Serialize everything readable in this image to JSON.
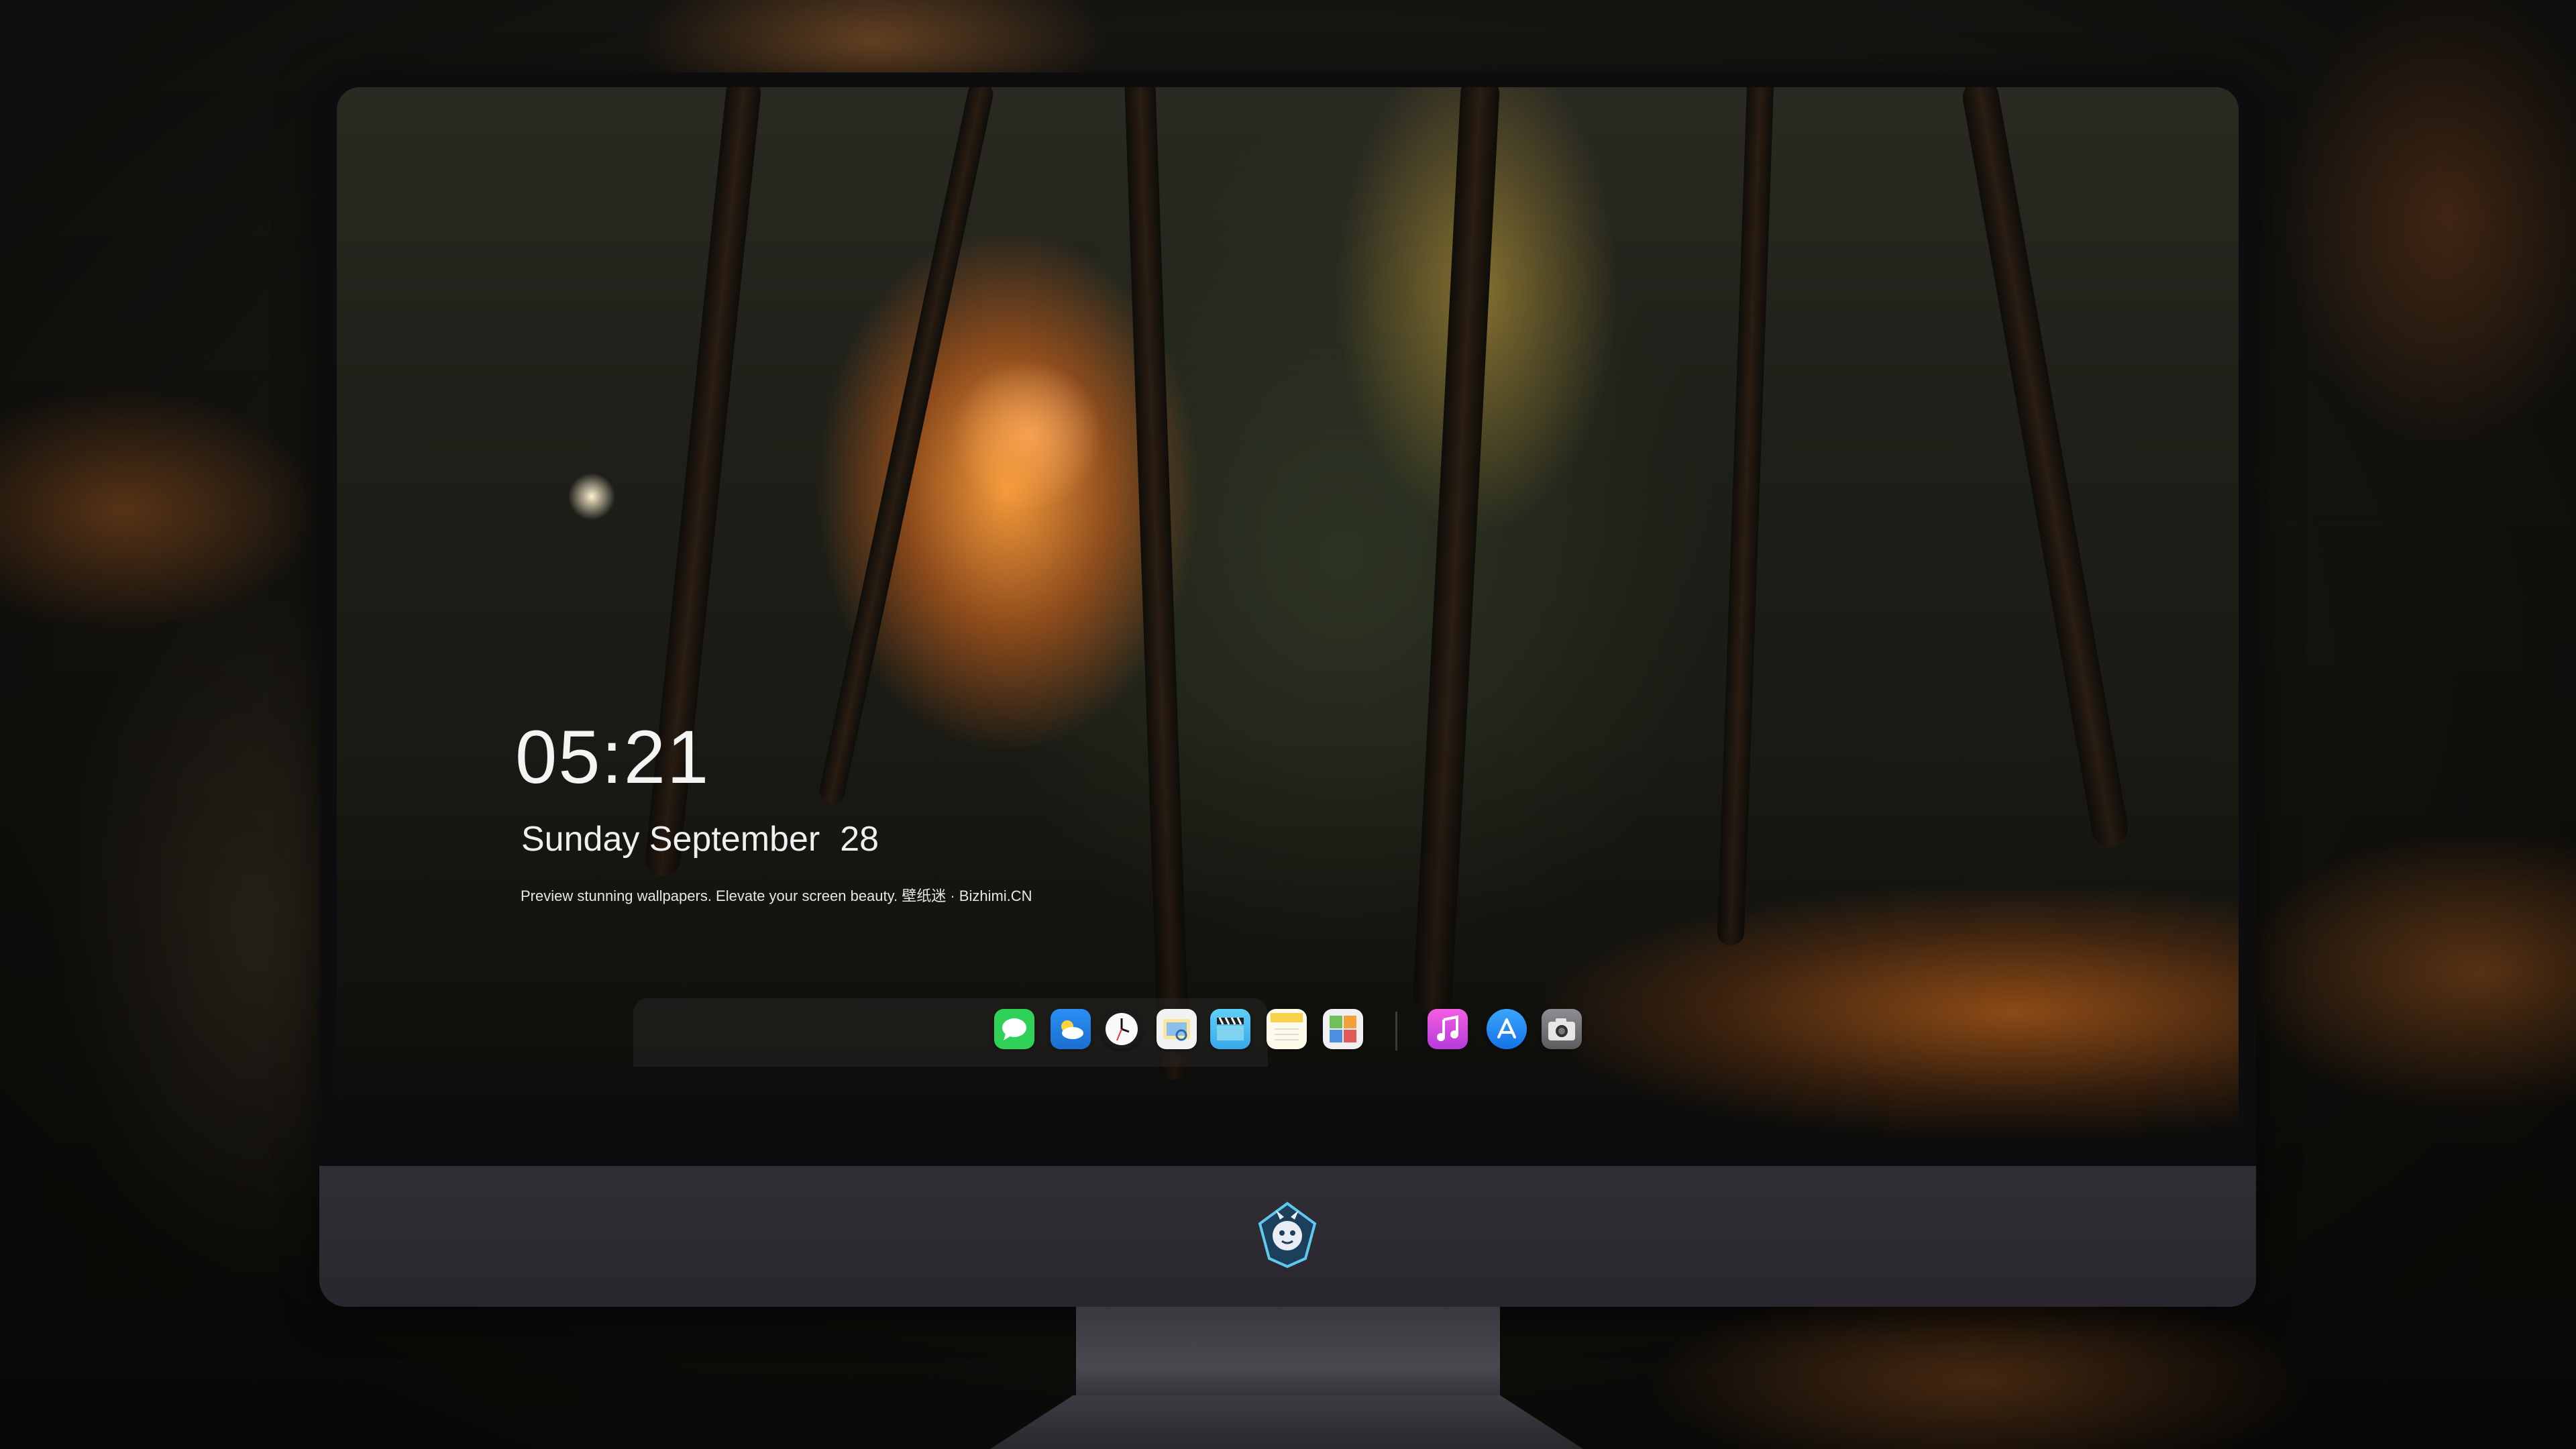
{
  "lock_screen": {
    "time": "05:21",
    "weekday_month": "Sunday September",
    "day": "28",
    "tagline": "Preview stunning wallpapers. Elevate your screen beauty. 壁纸迷 · Bizhimi.CN"
  },
  "dock": {
    "apps": [
      {
        "name": "messages-icon",
        "color": "#2fd158"
      },
      {
        "name": "weather-icon",
        "color": "#1e88f0"
      },
      {
        "name": "clock-icon",
        "color": "#1a1a1a"
      },
      {
        "name": "preview-icon",
        "color": "#f2f2f2"
      },
      {
        "name": "clips-icon",
        "color": "#4fc3f7"
      },
      {
        "name": "notes-icon",
        "color": "#fbe06b"
      },
      {
        "name": "photo-booth-icon",
        "color": "#f0f0f0"
      },
      {
        "name": "itunes-icon",
        "color": "#e34ed6"
      },
      {
        "name": "app-store-icon",
        "color": "#1a8cff"
      },
      {
        "name": "camera-icon",
        "color": "#7d7d80"
      }
    ]
  },
  "monitor": {
    "logo": "dragon-logo-icon"
  }
}
